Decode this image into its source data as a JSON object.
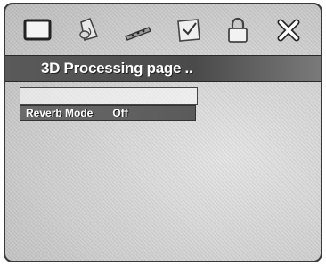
{
  "page": {
    "title": "3D Processing page .."
  },
  "tabs": [
    {
      "icon": "display-icon"
    },
    {
      "icon": "speaker-icon"
    },
    {
      "icon": "remote-icon"
    },
    {
      "icon": "checkbox-icon"
    },
    {
      "icon": "lock-icon"
    },
    {
      "icon": "close-icon"
    }
  ],
  "menu": {
    "items": [
      {
        "label": "",
        "value": ""
      },
      {
        "label": "Reverb Mode",
        "value": "Off"
      }
    ]
  }
}
